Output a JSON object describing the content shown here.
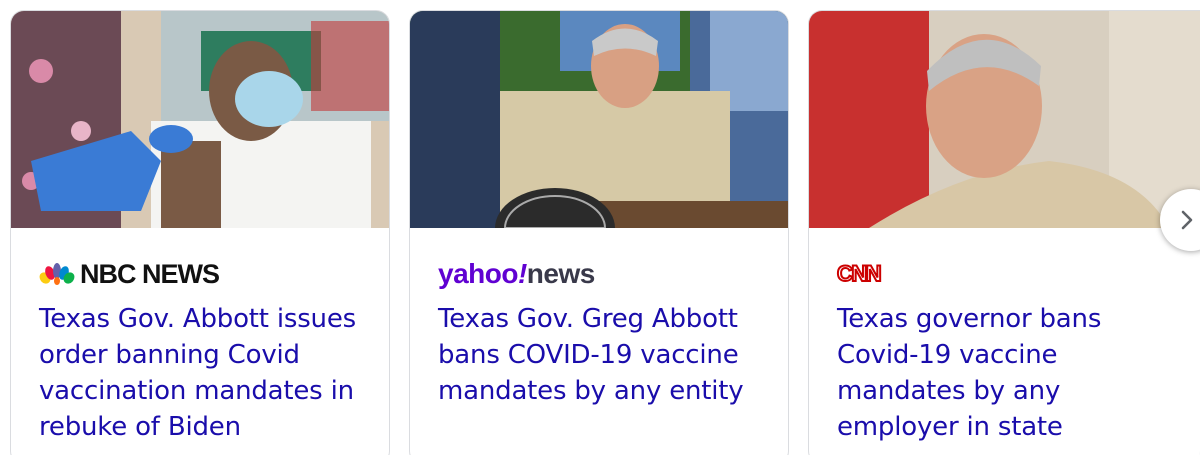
{
  "articles": [
    {
      "source": "NBC NEWS",
      "headline": "Texas Gov. Abbott issues order banning Covid vaccination mandates in rebuke of Biden"
    },
    {
      "source_brand": "yahoo",
      "source_bang": "!",
      "source_suffix": "news",
      "headline": "Texas Gov. Greg Abbott bans COVID-19 vaccine mandates by any entity"
    },
    {
      "source": "CNN",
      "headline": "Texas governor bans Covid-19 vaccine mandates by any employer in state"
    }
  ],
  "carousel": {
    "next_icon": "chevron-right-icon"
  },
  "colors": {
    "headline": "#1a0dab",
    "card_border": "#dadce0",
    "yahoo_purple": "#6001d2",
    "cnn_red": "#cc0000"
  }
}
